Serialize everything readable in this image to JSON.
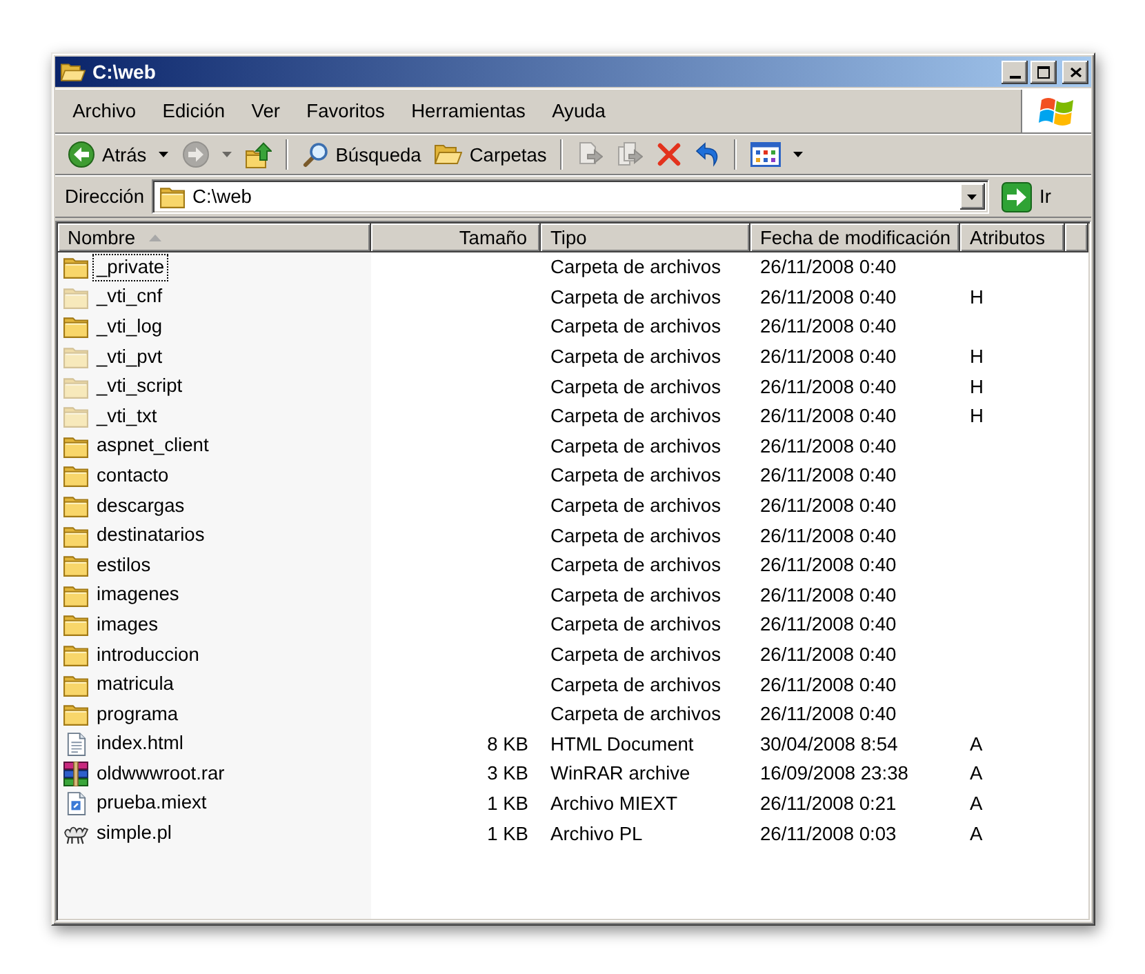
{
  "window": {
    "title": "C:\\web"
  },
  "menu": [
    {
      "label": "Archivo"
    },
    {
      "label": "Edición"
    },
    {
      "label": "Ver"
    },
    {
      "label": "Favoritos"
    },
    {
      "label": "Herramientas"
    },
    {
      "label": "Ayuda"
    }
  ],
  "toolbar": [
    {
      "kind": "back",
      "label": "Atrás",
      "dropdown": true,
      "disabled": false
    },
    {
      "kind": "forward",
      "dropdown": true,
      "disabled": true
    },
    {
      "kind": "up",
      "disabled": false
    },
    {
      "kind": "separator"
    },
    {
      "kind": "search",
      "label": "Búsqueda",
      "disabled": false
    },
    {
      "kind": "folders",
      "label": "Carpetas",
      "disabled": false
    },
    {
      "kind": "separator"
    },
    {
      "kind": "move",
      "disabled": true
    },
    {
      "kind": "copy",
      "disabled": true
    },
    {
      "kind": "delete",
      "disabled": false
    },
    {
      "kind": "undo",
      "disabled": false
    },
    {
      "kind": "separator"
    },
    {
      "kind": "views",
      "dropdown": true,
      "disabled": false
    }
  ],
  "address_bar": {
    "label": "Dirección",
    "value": "C:\\web",
    "go_label": "Ir"
  },
  "file_list": {
    "columns": [
      {
        "label": "Nombre",
        "sorted": true
      },
      {
        "label": "Tamaño",
        "sorted": false
      },
      {
        "label": "Tipo",
        "sorted": false
      },
      {
        "label": "Fecha de modificación",
        "sorted": false
      },
      {
        "label": "Atributos",
        "sorted": false
      }
    ],
    "rows": [
      {
        "name": "_private",
        "kind": "folder",
        "type": "Carpeta de archivos",
        "modified": "26/11/2008 0:40",
        "ghosted": false,
        "focused": true,
        "selected": false
      },
      {
        "name": "_vti_cnf",
        "kind": "folder",
        "type": "Carpeta de archivos",
        "modified": "26/11/2008 0:40",
        "attributes": "H",
        "ghosted": true,
        "focused": false,
        "selected": false
      },
      {
        "name": "_vti_log",
        "kind": "folder",
        "type": "Carpeta de archivos",
        "modified": "26/11/2008 0:40",
        "ghosted": false,
        "focused": false,
        "selected": false
      },
      {
        "name": "_vti_pvt",
        "kind": "folder",
        "type": "Carpeta de archivos",
        "modified": "26/11/2008 0:40",
        "attributes": "H",
        "ghosted": true,
        "focused": false,
        "selected": false
      },
      {
        "name": "_vti_script",
        "kind": "folder",
        "type": "Carpeta de archivos",
        "modified": "26/11/2008 0:40",
        "attributes": "H",
        "ghosted": true,
        "focused": false,
        "selected": false
      },
      {
        "name": "_vti_txt",
        "kind": "folder",
        "type": "Carpeta de archivos",
        "modified": "26/11/2008 0:40",
        "attributes": "H",
        "ghosted": true,
        "focused": false,
        "selected": false
      },
      {
        "name": "aspnet_client",
        "kind": "folder",
        "type": "Carpeta de archivos",
        "modified": "26/11/2008 0:40",
        "ghosted": false,
        "focused": false,
        "selected": false
      },
      {
        "name": "contacto",
        "kind": "folder",
        "type": "Carpeta de archivos",
        "modified": "26/11/2008 0:40",
        "ghosted": false,
        "focused": false,
        "selected": false
      },
      {
        "name": "descargas",
        "kind": "folder",
        "type": "Carpeta de archivos",
        "modified": "26/11/2008 0:40",
        "ghosted": false,
        "focused": false,
        "selected": false
      },
      {
        "name": "destinatarios",
        "kind": "folder",
        "type": "Carpeta de archivos",
        "modified": "26/11/2008 0:40",
        "ghosted": false,
        "focused": false,
        "selected": false
      },
      {
        "name": "estilos",
        "kind": "folder",
        "type": "Carpeta de archivos",
        "modified": "26/11/2008 0:40",
        "ghosted": false,
        "focused": false,
        "selected": false
      },
      {
        "name": "imagenes",
        "kind": "folder",
        "type": "Carpeta de archivos",
        "modified": "26/11/2008 0:40",
        "ghosted": false,
        "focused": false,
        "selected": false
      },
      {
        "name": "images",
        "kind": "folder",
        "type": "Carpeta de archivos",
        "modified": "26/11/2008 0:40",
        "ghosted": false,
        "focused": false,
        "selected": false
      },
      {
        "name": "introduccion",
        "kind": "folder",
        "type": "Carpeta de archivos",
        "modified": "26/11/2008 0:40",
        "ghosted": false,
        "focused": false,
        "selected": false
      },
      {
        "name": "matricula",
        "kind": "folder",
        "type": "Carpeta de archivos",
        "modified": "26/11/2008 0:40",
        "ghosted": false,
        "focused": false,
        "selected": false
      },
      {
        "name": "programa",
        "kind": "folder",
        "type": "Carpeta de archivos",
        "modified": "26/11/2008 0:40",
        "ghosted": false,
        "focused": false,
        "selected": false
      },
      {
        "name": "index.html",
        "kind": "html",
        "size": "8 KB",
        "type": "HTML Document",
        "modified": "30/04/2008 8:54",
        "attributes": "A",
        "ghosted": false,
        "focused": false,
        "selected": false
      },
      {
        "name": "oldwwwroot.rar",
        "kind": "rar",
        "size": "3 KB",
        "type": "WinRAR archive",
        "modified": "16/09/2008 23:38",
        "attributes": "A",
        "ghosted": false,
        "focused": false,
        "selected": false
      },
      {
        "name": "prueba.miext",
        "kind": "miext",
        "size": "1 KB",
        "type": "Archivo MIEXT",
        "modified": "26/11/2008 0:21",
        "attributes": "A",
        "ghosted": false,
        "focused": false,
        "selected": false
      },
      {
        "name": "simple.pl",
        "kind": "perl",
        "size": "1 KB",
        "type": "Archivo PL",
        "modified": "26/11/2008 0:03",
        "attributes": "A",
        "ghosted": false,
        "focused": false,
        "selected": false
      }
    ]
  }
}
